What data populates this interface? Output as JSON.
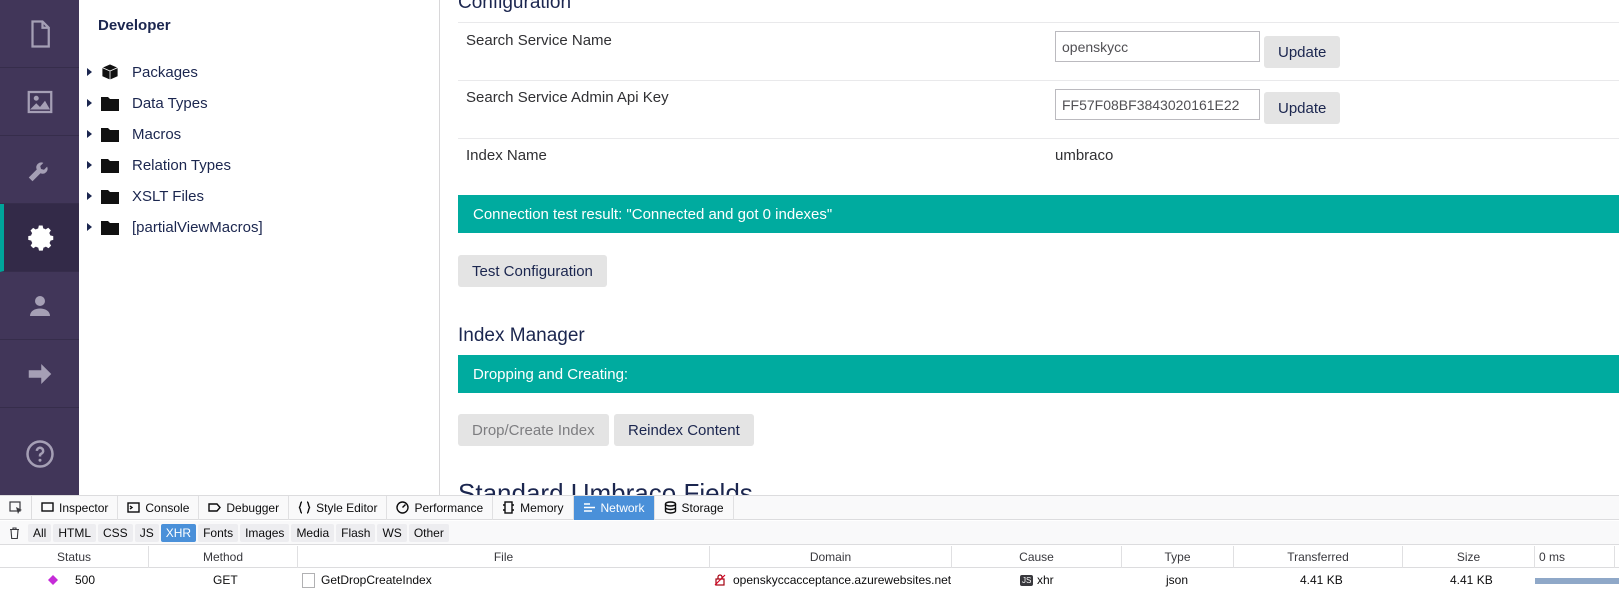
{
  "sidebar": {
    "icons": [
      {
        "name": "content-icon"
      },
      {
        "name": "media-icon"
      },
      {
        "name": "settings-wrench-icon"
      },
      {
        "name": "developer-gear-icon",
        "active": true
      },
      {
        "name": "users-icon"
      },
      {
        "name": "forms-arrow-icon"
      },
      {
        "name": "help-icon"
      }
    ]
  },
  "tree": {
    "title": "Developer",
    "items": [
      {
        "label": "Packages",
        "icon": "package-icon"
      },
      {
        "label": "Data Types",
        "icon": "folder-icon"
      },
      {
        "label": "Macros",
        "icon": "folder-icon"
      },
      {
        "label": "Relation Types",
        "icon": "folder-icon"
      },
      {
        "label": "XSLT Files",
        "icon": "folder-icon"
      },
      {
        "label": "[partialViewMacros]",
        "icon": "folder-icon"
      }
    ]
  },
  "config": {
    "title": "Configuration",
    "service_name_label": "Search Service Name",
    "service_name_value": "openskycc",
    "api_key_label": "Search Service Admin Api Key",
    "api_key_value": "FF57F08BF3843020161E22",
    "update_label": "Update",
    "index_name_label": "Index Name",
    "index_name_value": "umbraco",
    "connection_result": "Connection test result: \"Connected and got 0 indexes\"",
    "test_button": "Test Configuration"
  },
  "index_manager": {
    "title": "Index Manager",
    "status": "Dropping and Creating:",
    "drop_button": "Drop/Create Index",
    "reindex_button": "Reindex Content"
  },
  "next_section_title": "Standard Umbraco Fields",
  "colors": {
    "rail_bg": "#413659",
    "accent": "#00ab9f",
    "devtools_active": "#4a90d9"
  },
  "devtools": {
    "tabs": [
      "Inspector",
      "Console",
      "Debugger",
      "Style Editor",
      "Performance",
      "Memory",
      "Network",
      "Storage"
    ],
    "active_tab": "Network",
    "filters": [
      "All",
      "HTML",
      "CSS",
      "JS",
      "XHR",
      "Fonts",
      "Images",
      "Media",
      "Flash",
      "WS",
      "Other"
    ],
    "active_filter": "XHR",
    "columns": [
      "Status",
      "Method",
      "File",
      "Domain",
      "Cause",
      "Type",
      "Transferred",
      "Size",
      "0 ms"
    ],
    "request": {
      "status": "500",
      "method": "GET",
      "file": "GetDropCreateIndex",
      "domain": "openskyccacceptance.azurewebsites.net",
      "cause": "xhr",
      "cause_badge": "JS",
      "type": "json",
      "transferred": "4.41 KB",
      "size": "4.41 KB"
    }
  }
}
